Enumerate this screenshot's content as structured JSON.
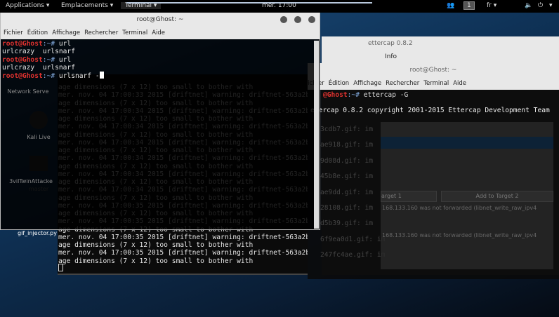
{
  "topbar": {
    "applications": "Applications ▾",
    "places": "Emplacements ▾",
    "terminal": "Terminal ▾",
    "clock": "mer. 17:00",
    "workspace": "1",
    "lang": "fr ▾",
    "power_menu": "▾"
  },
  "desktop": {
    "icons": [
      "Network Serve",
      "Kali Live",
      "3vilTwinAttacke",
      "master",
      "gif_injector.py"
    ]
  },
  "front_terminal": {
    "title": "root@Ghost: ~",
    "menu": [
      "Fichier",
      "Édition",
      "Affichage",
      "Rechercher",
      "Terminal",
      "Aide"
    ],
    "lines": [
      {
        "p": "root@Ghost",
        "s": ":~#",
        "c": " url"
      },
      {
        "t": "urlcrazy  urlsnarf"
      },
      {
        "p": "root@Ghost",
        "s": ":~#",
        "c": " url"
      },
      {
        "t": "urlcrazy  urlsnarf"
      },
      {
        "p": "root@Ghost",
        "s": ":~#",
        "c": " urlsnarf -"
      }
    ]
  },
  "driftnet_terminal": {
    "lines": [
      "age dimensions (7 x 12) too small to bother with",
      "mer. nov. 04 17:00:33 2015 [driftnet] warning: driftnet-563a2ba",
      "age dimensions (7 x 12) too small to bother with",
      "mer. nov. 04 17:00:34 2015 [driftnet] warning: driftnet-563a2ba",
      "age dimensions (7 x 12) too small to bother with",
      "mer. nov. 04 17:00:34 2015 [driftnet] warning: driftnet-563a2ba",
      "age dimensions (7 x 12) too small to bother with",
      "mer. nov. 04 17:00:34 2015 [driftnet] warning: driftnet-563a2ba",
      "age dimensions (7 x 12) too small to bother with",
      "mer. nov. 04 17:00:34 2015 [driftnet] warning: driftnet-563a2ba",
      "age dimensions (7 x 12) too small to bother with",
      "mer. nov. 04 17:00:34 2015 [driftnet] warning: driftnet-563a2ba",
      "age dimensions (7 x 12) too small to bother with",
      "mer. nov. 04 17:00:34 2015 [driftnet] warning: driftnet-563a2ba",
      "age dimensions (7 x 12) too small to bother with",
      "mer. nov. 04 17:00:35 2015 [driftnet] warning: driftnet-563a2ba",
      "age dimensions (7 x 12) too small to bother with",
      "mer. nov. 04 17:00:35 2015 [driftnet] warning: driftnet-563a2ba",
      "age dimensions (7 x 12) too small to bother with",
      "mer. nov. 04 17:00:35 2015 [driftnet] warning: driftnet-563a2ba",
      "age dimensions (7 x 12) too small to bother with",
      "mer. nov. 04 17:00:35 2015 [driftnet] warning: driftnet-563a2ba",
      "age dimensions (7 x 12) too small to bother with"
    ]
  },
  "gif_fragments": [
    "3cdb7.gif: im",
    "ae918.gif: im",
    "9d08d.gif: im",
    "45b8e.gif: im",
    "ae9dd.gif: im",
    "28108.gif: im",
    "d5b39.gif: im",
    "6f9ea0d1.gif: im",
    "247fc4ae.gif: im"
  ],
  "ettercap": {
    "title": "ettercap 0.8.2",
    "menu_info": "Info",
    "btn1": "arget 1",
    "btn2": "Add to Target 2",
    "log": [
      "168.133.160 was not forwarded (libnet_write_raw_ipv4",
      "168.133.160 was not forwarded (libnet_write_raw_ipv4"
    ]
  },
  "right_terminal": {
    "title": "root@Ghost: ~",
    "menu": [
      "Fichier",
      "Édition",
      "Affichage",
      "Rechercher",
      "Terminal",
      "Aide"
    ],
    "prompt": "@Ghost",
    "sep": ":~#",
    "cmd": " ettercap -G",
    "output": "etercap 0.8.2 copyright 2001-2015 Ettercap Development Team"
  }
}
